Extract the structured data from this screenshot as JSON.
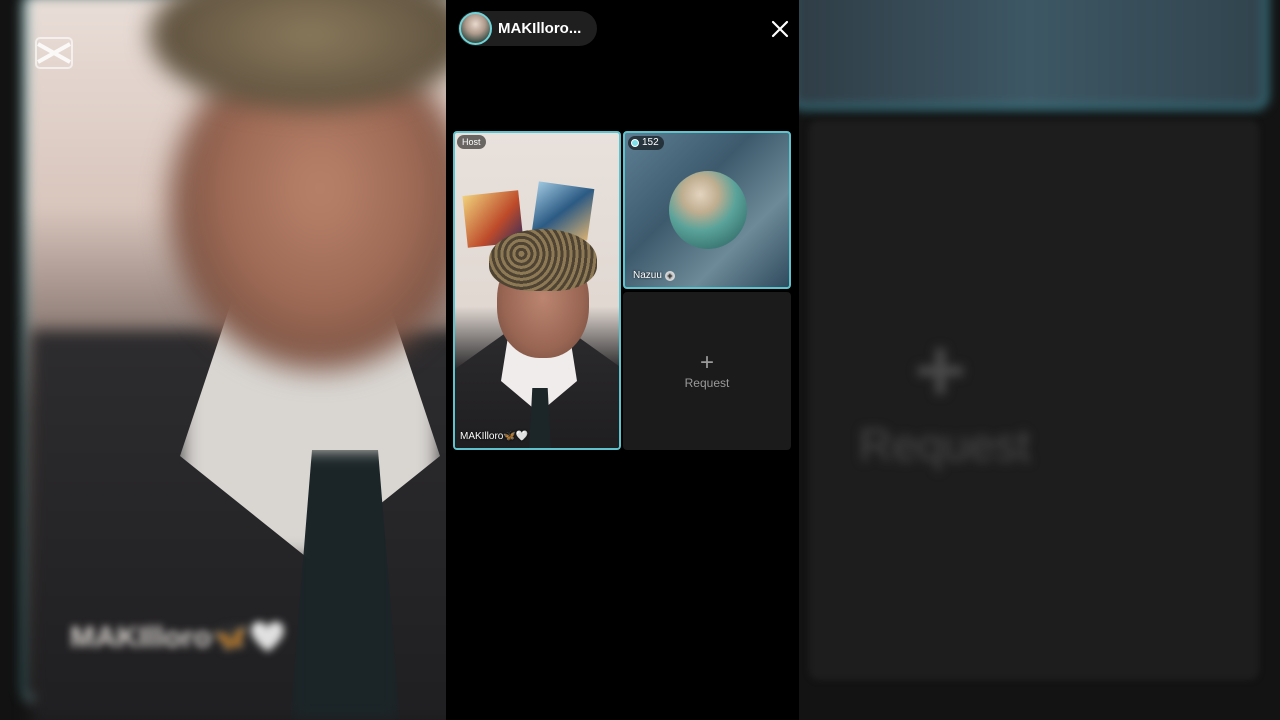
{
  "header": {
    "host_name": "MAKIlloro..."
  },
  "grid": {
    "host_tile": {
      "badge": "Host",
      "name": "MAKIlloro🦋🤍"
    },
    "guest_tile": {
      "viewer_count": "152",
      "name": "Nazuu"
    },
    "request_tile": {
      "plus": "+",
      "label": "Request"
    }
  },
  "background": {
    "left_blur_name": "MAKIlloro🦋🤍",
    "right_blur_label": "Request"
  },
  "colors": {
    "accent_border": "#5fc3cd",
    "panel_bg": "#000000",
    "request_tile_bg": "#1b1b1b"
  },
  "icons": {
    "close": "close-icon",
    "watermark": "capcut-logo-icon",
    "add_guest": "plus-icon"
  }
}
